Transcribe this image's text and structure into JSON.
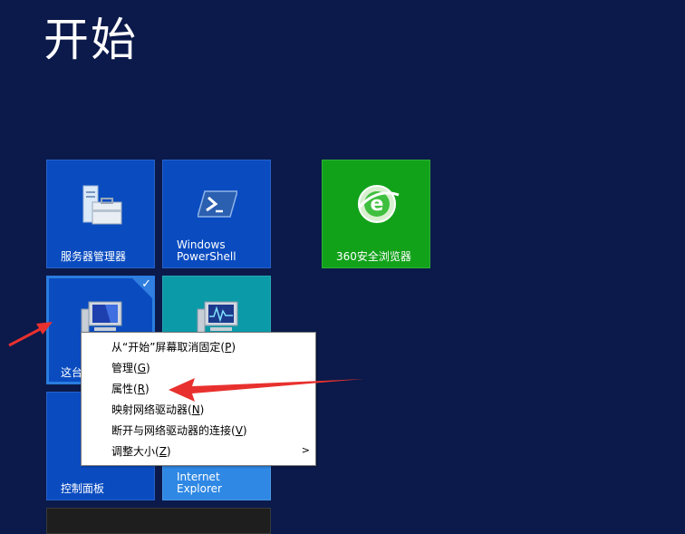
{
  "start": {
    "title": "开始"
  },
  "tiles": {
    "server_manager": {
      "label": "服务器管理器"
    },
    "powershell": {
      "label": "Windows\nPowerShell"
    },
    "browser_360": {
      "label": "360安全浏览器"
    },
    "this_pc": {
      "label": "这台电脑",
      "visible_label": "这台"
    },
    "perf_monitor": {
      "label": ""
    },
    "control_panel": {
      "label": "控制面板"
    },
    "ie": {
      "label": "Internet\nExplorer"
    }
  },
  "context_menu": {
    "items": [
      {
        "text": "从“开始”屏幕取消固定(",
        "key": "P",
        "end": ")"
      },
      {
        "text": "管理(",
        "key": "G",
        "end": ")"
      },
      {
        "text": "属性(",
        "key": "R",
        "end": ")"
      },
      {
        "text": "映射网络驱动器(",
        "key": "N",
        "end": ")"
      },
      {
        "text": "断开与网络驱动器的连接(",
        "key": "V",
        "end": ")"
      },
      {
        "text": "调整大小(",
        "key": "Z",
        "end": ")"
      }
    ],
    "submenu_indicator": ">"
  },
  "colors": {
    "background": "#0b1a4a",
    "tile_blue": "#0a4cc0",
    "tile_teal": "#0b9aa8",
    "tile_green": "#12a21a",
    "tile_lightblue": "#2f88e4",
    "annotation_arrow": "#e8312e"
  }
}
